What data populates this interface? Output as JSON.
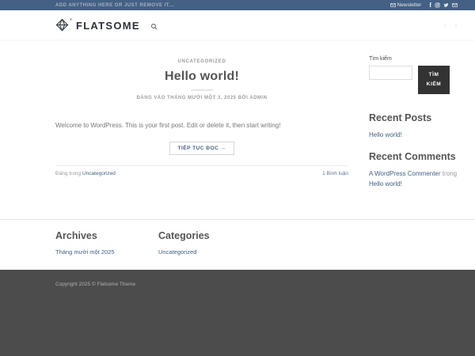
{
  "colors": {
    "primary": "#446084",
    "search_button_bg": "#333333",
    "copyright_bg": "#4c4c4c"
  },
  "topbar": {
    "left_text": "ADD ANYTHING HERE OR JUST REMOVE IT...",
    "newsletter_label": "Newsletter",
    "social_icons": [
      "facebook",
      "instagram",
      "twitter",
      "email"
    ]
  },
  "header": {
    "logo_text": "FLATSOME",
    "prev_arrow": "‹",
    "next_arrow": "›"
  },
  "post": {
    "category": "UNCATEGORIZED",
    "title": "Hello world!",
    "meta": "ĐĂNG VÀO THÁNG MƯỜI MỘT 3, 2025 BỞI ADMIN",
    "excerpt": "Welcome to WordPress. This is your first post. Edit or delete it, then start writing!",
    "read_more": "TIẾP TỤC ĐỌC →",
    "posted_in_label": "Đăng trong",
    "posted_in_category": "Uncategorized",
    "comments_link": "1 Bình luận"
  },
  "sidebar": {
    "search_label": "Tìm kiếm",
    "search_button": "TÌM KIẾM",
    "search_value": "",
    "recent_posts_title": "Recent Posts",
    "recent_posts": [
      "Hello world!"
    ],
    "recent_comments_title": "Recent Comments",
    "recent_comments": [
      {
        "author": "A WordPress Commenter",
        "prefix": "trong",
        "post": "Hello world!"
      }
    ]
  },
  "footer": {
    "archives_title": "Archives",
    "archives": [
      "Tháng mười một 2025"
    ],
    "categories_title": "Categories",
    "categories": [
      "Uncategorized"
    ],
    "copyright": "Copyright 2025 © Flatsome Theme"
  }
}
